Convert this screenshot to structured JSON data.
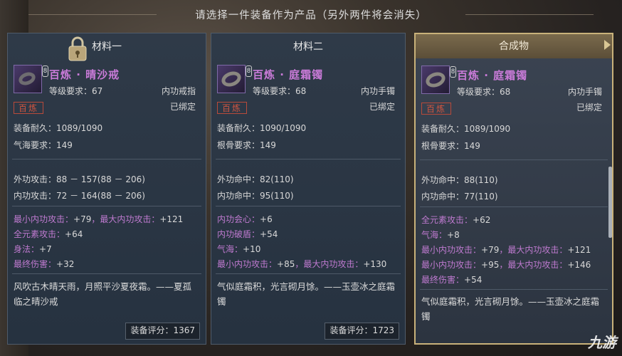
{
  "header": {
    "title": "请选择一件装备作为产品（另外两件将会消失）"
  },
  "panels": [
    {
      "title": "材料一",
      "name": "百炼 · 晴沙戒",
      "level": "等级要求：67",
      "type": "内功戒指",
      "stamp": "百炼",
      "bound": "已绑定",
      "durability": "装备耐久：1089/1090",
      "req": "气海要求：149",
      "stats": [
        "外功攻击：88 － 157(88 － 206)",
        "内功攻击：72 － 164(88 － 206)"
      ],
      "bonus": [
        {
          "label": "最小内功攻击：",
          "value": "+79",
          "label2": "，最大内功攻击：",
          "value2": "+121"
        },
        {
          "label": "全元素攻击：",
          "value": "+64"
        },
        {
          "label": "身法：",
          "value": "+7"
        },
        {
          "label": "最终伤害：",
          "value": "+32"
        }
      ],
      "desc": "风吹古木晴天雨，月照平沙夏夜霜。——夏孤临之晴沙戒",
      "score": "装备评分：1367"
    },
    {
      "title": "材料二",
      "name": "百炼 · 庭霜镯",
      "level": "等级要求：68",
      "type": "内功手镯",
      "stamp": "百炼",
      "bound": "已绑定",
      "durability": "装备耐久：1090/1090",
      "req": "根骨要求：149",
      "stats": [
        "外功命中：82(110)",
        "内功命中：95(110)"
      ],
      "bonus": [
        {
          "label": "内功会心：",
          "value": "+6"
        },
        {
          "label": "内功破盾：",
          "value": "+54"
        },
        {
          "label": "气海：",
          "value": "+10"
        },
        {
          "label": "最小内功攻击：",
          "value": "+85",
          "label2": "，最大内功攻击：",
          "value2": "+130"
        }
      ],
      "desc": "气似庭霜积，光言砌月馀。——玉壶冰之庭霜镯",
      "score": "装备评分：1723"
    },
    {
      "title": "合成物",
      "name": "百炼 · 庭霜镯",
      "level": "等级要求：68",
      "type": "内功手镯",
      "stamp": "百炼",
      "bound": "已绑定",
      "durability": "装备耐久：1089/1090",
      "req": "根骨要求：149",
      "stats": [
        "外功命中：88(110)",
        "内功命中：77(110)"
      ],
      "bonus": [
        {
          "label": "全元素攻击：",
          "value": "+62"
        },
        {
          "label": "气海：",
          "value": "+8"
        },
        {
          "label": "最小内功攻击：",
          "value": "+79",
          "label2": "，最大内功攻击：",
          "value2": "+121"
        },
        {
          "label": "最小内功攻击：",
          "value": "+95",
          "label2": "，最大内功攻击：",
          "value2": "+146"
        },
        {
          "label": "最终伤害：",
          "value": "+54"
        }
      ],
      "desc": "气似庭霜积，光言砌月馀。——玉壶冰之庭霜镯",
      "score": ""
    }
  ],
  "watermark": "九游"
}
